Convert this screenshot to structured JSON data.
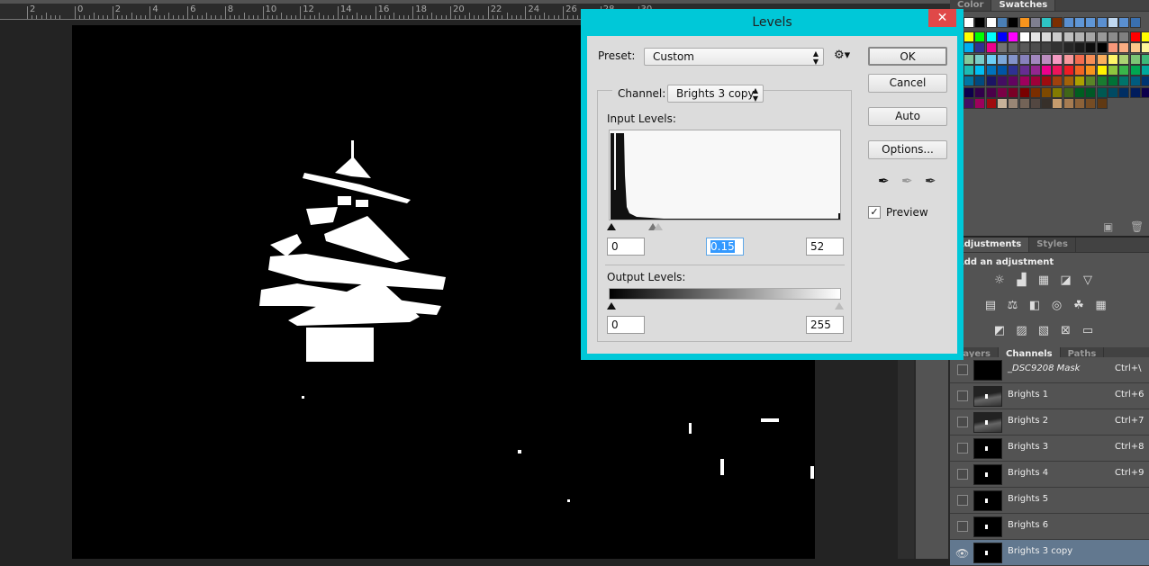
{
  "ruler": {
    "labels": [
      "2",
      "0",
      "2",
      "4",
      "6",
      "8",
      "10",
      "12",
      "14",
      "16",
      "18",
      "20",
      "22",
      "24",
      "26",
      "28",
      "30"
    ]
  },
  "swatches_panel": {
    "tabs": [
      "Color",
      "Swatches"
    ],
    "active_tab": "Swatches",
    "recent": [
      "#ffffff",
      "#000000",
      "#ffffff",
      "#4a7fb5",
      "#000000",
      "#f7941d",
      "#7f7f8f",
      "#2ec4c4",
      "#7b2e00",
      "#5a8fd0",
      "#5f96d6",
      "#5f96d6",
      "#5a8fd0",
      "#c0d8f0",
      "#5a8fd0",
      "#3a70b0"
    ],
    "grid": [
      [
        "#ffff00",
        "#00ff00",
        "#00ffff",
        "#0000ff",
        "#ff00ff",
        "#ffffff",
        "#e6e6e6",
        "#d9d9d9",
        "#cccccc",
        "#bfbfbf",
        "#b3b3b3",
        "#a6a6a6",
        "#999999",
        "#8c8c8c",
        "#808080",
        "#ff0000",
        "#ffff00"
      ],
      [
        "#00aeef",
        "#2e3192",
        "#ec008c",
        "#737373",
        "#666666",
        "#595959",
        "#4d4d4d",
        "#404040",
        "#333333",
        "#262626",
        "#1a1a1a",
        "#0d0d0d",
        "#000000",
        "#f7977a",
        "#fbad82",
        "#fdc68a",
        "#fff799"
      ],
      [
        "#82ca9c",
        "#7accc8",
        "#6dcff6",
        "#7da7d9",
        "#8393ca",
        "#8781bd",
        "#a187be",
        "#bc8dbf",
        "#f49ac2",
        "#f6989d",
        "#f26c4f",
        "#f68e56",
        "#fbaf5d",
        "#fff568",
        "#acd373",
        "#7cc576",
        "#3cb878"
      ],
      [
        "#1cbbb4",
        "#00bff3",
        "#0072bc",
        "#0054a6",
        "#2e3192",
        "#662d91",
        "#92278f",
        "#ec008c",
        "#ed145b",
        "#ed1c24",
        "#f26522",
        "#f7941d",
        "#fff200",
        "#8dc63f",
        "#39b54a",
        "#00a651",
        "#00a99d"
      ],
      [
        "#0076a3",
        "#004a80",
        "#1b1464",
        "#440e62",
        "#630460",
        "#9e005d",
        "#9e0039",
        "#9e0b0f",
        "#a0410d",
        "#a36209",
        "#aba000",
        "#598527",
        "#197b30",
        "#007236",
        "#00746b",
        "#005b7f",
        "#003471"
      ],
      [
        "#0d004c",
        "#32004b",
        "#4b0049",
        "#7b0046",
        "#7a0026",
        "#790000",
        "#7b2e00",
        "#7d4900",
        "#827b00",
        "#406618",
        "#005e20",
        "#005826",
        "#005952",
        "#004a63",
        "#002e63",
        "#001c5c",
        "#0d004c"
      ],
      [
        "#440e62",
        "#9e005d",
        "#9e0b0f",
        "#c7b299",
        "#998675",
        "#736357",
        "#534741",
        "#37302a",
        "#c69c6d",
        "#a67c52",
        "#8c6239",
        "#754c24",
        "#603913"
      ]
    ]
  },
  "adjustments_panel": {
    "tabs": [
      "Adjustments",
      "Styles"
    ],
    "active_tab": "Adjustments",
    "heading": "Add an adjustment",
    "rows": [
      [
        "brightness-contrast",
        "levels",
        "curves",
        "exposure",
        "vibrance"
      ],
      [
        "hue-saturation",
        "color-balance",
        "black-white",
        "photo-filter",
        "channel-mixer",
        "color-lookup"
      ],
      [
        "invert",
        "posterize",
        "threshold",
        "selective-color",
        "gradient-map"
      ]
    ]
  },
  "channels_panel": {
    "tabs": [
      "Layers",
      "Channels",
      "Paths"
    ],
    "active_tab": "Channels",
    "rows": [
      {
        "name": "_DSC9208 Mask",
        "shortcut": "Ctrl+\\",
        "visible": false,
        "selected": false
      },
      {
        "name": "Brights 1",
        "shortcut": "Ctrl+6",
        "visible": false,
        "selected": false
      },
      {
        "name": "Brights 2",
        "shortcut": "Ctrl+7",
        "visible": false,
        "selected": false
      },
      {
        "name": "Brights 3",
        "shortcut": "Ctrl+8",
        "visible": false,
        "selected": false
      },
      {
        "name": "Brights 4",
        "shortcut": "Ctrl+9",
        "visible": false,
        "selected": false
      },
      {
        "name": "Brights 5",
        "shortcut": "",
        "visible": false,
        "selected": false
      },
      {
        "name": "Brights 6",
        "shortcut": "",
        "visible": false,
        "selected": false
      },
      {
        "name": "Brights 3 copy",
        "shortcut": "",
        "visible": true,
        "selected": true
      }
    ]
  },
  "levels": {
    "title": "Levels",
    "close": "✕",
    "preset_label": "Preset:",
    "preset_value": "Custom",
    "channel_label": "Channel:",
    "channel_value": "Brights 3 copy",
    "input_label": "Input Levels:",
    "input_black": "0",
    "input_gamma": "0.15",
    "input_white": "52",
    "output_label": "Output Levels:",
    "output_black": "0",
    "output_white": "255",
    "buttons": {
      "ok": "OK",
      "cancel": "Cancel",
      "auto": "Auto",
      "options": "Options..."
    },
    "preview_label": "Preview",
    "preview_checked": true,
    "accent": "#00c8d8"
  }
}
